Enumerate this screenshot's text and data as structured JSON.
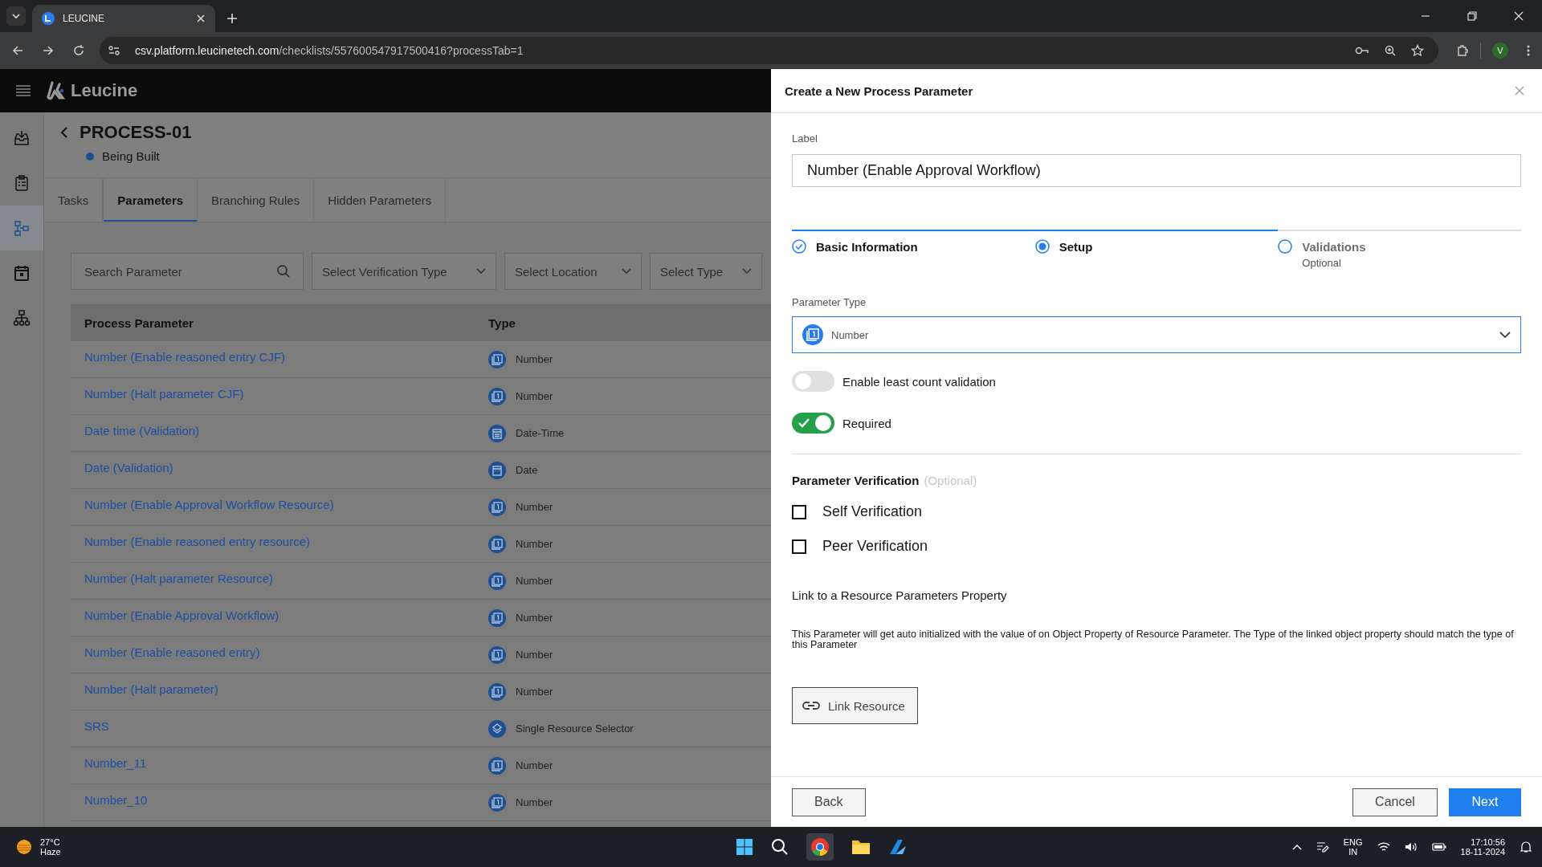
{
  "browser": {
    "tab_title": "LEUCINE",
    "url_host": "csv.platform.leucinetech.com",
    "url_path": "/checklists/557600547917500416?processTab=1",
    "profile_initial": "V"
  },
  "app": {
    "brand": "Leucine"
  },
  "sidebar": {
    "items": [
      {
        "kind": "inbox",
        "selected": false
      },
      {
        "kind": "clipboard",
        "selected": false
      },
      {
        "kind": "flow",
        "selected": true
      },
      {
        "kind": "calendar",
        "selected": false
      },
      {
        "kind": "hierarchy",
        "selected": false
      }
    ]
  },
  "page": {
    "title": "PROCESS-01",
    "status": {
      "label": "Being Built",
      "color": "#1d4f91"
    }
  },
  "tabs": [
    {
      "label": "Tasks",
      "selected": false
    },
    {
      "label": "Parameters",
      "selected": true
    },
    {
      "label": "Branching Rules",
      "selected": false
    },
    {
      "label": "Hidden Parameters",
      "selected": false
    }
  ],
  "filters": {
    "search": {
      "placeholder": "Search Parameter"
    },
    "selects": [
      "Select Verification Type",
      "Select Location",
      "Select Type"
    ]
  },
  "table": {
    "columns": [
      "Process Parameter",
      "Type"
    ],
    "rows": [
      {
        "name": "Number (Enable reasoned entry CJF)",
        "type": "Number",
        "kind": "number"
      },
      {
        "name": "Number (Halt parameter CJF)",
        "type": "Number",
        "kind": "number"
      },
      {
        "name": "Date time (Validation)",
        "type": "Date-Time",
        "kind": "datetime"
      },
      {
        "name": "Date (Validation)",
        "type": "Date",
        "kind": "date"
      },
      {
        "name": "Number (Enable Approval Workflow Resource)",
        "type": "Number",
        "kind": "number"
      },
      {
        "name": "Number (Enable reasoned entry resource)",
        "type": "Number",
        "kind": "number"
      },
      {
        "name": "Number (Halt parameter Resource)",
        "type": "Number",
        "kind": "number"
      },
      {
        "name": "Number (Enable Approval Workflow)",
        "type": "Number",
        "kind": "number"
      },
      {
        "name": "Number (Enable reasoned entry)",
        "type": "Number",
        "kind": "number"
      },
      {
        "name": "Number (Halt parameter)",
        "type": "Number",
        "kind": "number"
      },
      {
        "name": "SRS",
        "type": "Single Resource Selector",
        "kind": "resource"
      },
      {
        "name": "Number_11",
        "type": "Number",
        "kind": "number"
      },
      {
        "name": "Number_10",
        "type": "Number",
        "kind": "number"
      }
    ]
  },
  "modal": {
    "title": "Create a New Process Parameter",
    "label_field": {
      "label": "Label",
      "value": "Number (Enable Approval Workflow)"
    },
    "steps": [
      {
        "label": "Basic Information",
        "completed": true,
        "selected": false
      },
      {
        "label": "Setup",
        "completed": false,
        "selected": true
      },
      {
        "label": "Validations",
        "sublabel": "Optional",
        "completed": false,
        "selected": false
      }
    ],
    "parameter_type": {
      "label": "Parameter Type",
      "value": "Number"
    },
    "toggles": [
      {
        "label": "Enable least count validation",
        "on": false
      },
      {
        "label": "Required",
        "on": true
      }
    ],
    "verification": {
      "title": "Parameter Verification",
      "hint": "(Optional)",
      "options": [
        {
          "label": "Self Verification",
          "checked": false
        },
        {
          "label": "Peer Verification",
          "checked": false
        }
      ]
    },
    "link": {
      "title": "Link to a Resource Parameters Property",
      "description": "This Parameter will get auto initialized with the value of on Object Property of Resource Parameter. The Type of the linked object property should match the type of this Parameter",
      "button": "Link Resource"
    },
    "footer": {
      "back": "Back",
      "cancel": "Cancel",
      "next": "Next"
    }
  },
  "taskbar": {
    "weather": {
      "temp": "27°C",
      "condition": "Haze"
    },
    "language": {
      "code": "ENG",
      "region": "IN"
    },
    "time": "17:10:56",
    "date": "18-11-2024"
  }
}
